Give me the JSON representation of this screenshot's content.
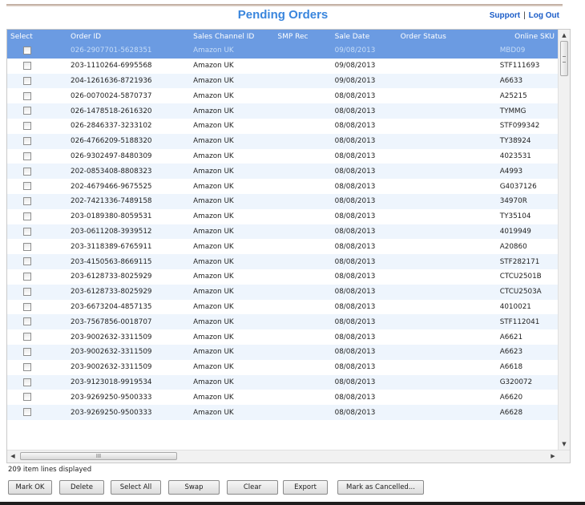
{
  "header": {
    "title": "Pending Orders",
    "support_label": "Support",
    "separator": "|",
    "logout_label": "Log Out"
  },
  "table": {
    "columns": [
      "Select",
      "Order ID",
      "Sales Channel ID",
      "SMP Rec",
      "Sale Date",
      "Order Status",
      "Online SKU"
    ],
    "rows": [
      {
        "order_id": "026-2907701-5628351",
        "channel": "Amazon UK",
        "smp": "",
        "date": "09/08/2013",
        "status": "",
        "sku": "MBD09",
        "selected": true
      },
      {
        "order_id": "203-1110264-6995568",
        "channel": "Amazon UK",
        "smp": "",
        "date": "09/08/2013",
        "status": "",
        "sku": "STF111693"
      },
      {
        "order_id": "204-1261636-8721936",
        "channel": "Amazon UK",
        "smp": "",
        "date": "09/08/2013",
        "status": "",
        "sku": "A6633"
      },
      {
        "order_id": "026-0070024-5870737",
        "channel": "Amazon UK",
        "smp": "",
        "date": "08/08/2013",
        "status": "",
        "sku": "A25215"
      },
      {
        "order_id": "026-1478518-2616320",
        "channel": "Amazon UK",
        "smp": "",
        "date": "08/08/2013",
        "status": "",
        "sku": "TYMMG"
      },
      {
        "order_id": "026-2846337-3233102",
        "channel": "Amazon UK",
        "smp": "",
        "date": "08/08/2013",
        "status": "",
        "sku": "STF099342"
      },
      {
        "order_id": "026-4766209-5188320",
        "channel": "Amazon UK",
        "smp": "",
        "date": "08/08/2013",
        "status": "",
        "sku": "TY38924"
      },
      {
        "order_id": "026-9302497-8480309",
        "channel": "Amazon UK",
        "smp": "",
        "date": "08/08/2013",
        "status": "",
        "sku": "4023531"
      },
      {
        "order_id": "202-0853408-8808323",
        "channel": "Amazon UK",
        "smp": "",
        "date": "08/08/2013",
        "status": "",
        "sku": "A4993"
      },
      {
        "order_id": "202-4679466-9675525",
        "channel": "Amazon UK",
        "smp": "",
        "date": "08/08/2013",
        "status": "",
        "sku": "G4037126"
      },
      {
        "order_id": "202-7421336-7489158",
        "channel": "Amazon UK",
        "smp": "",
        "date": "08/08/2013",
        "status": "",
        "sku": "34970R"
      },
      {
        "order_id": "203-0189380-8059531",
        "channel": "Amazon UK",
        "smp": "",
        "date": "08/08/2013",
        "status": "",
        "sku": "TY35104"
      },
      {
        "order_id": "203-0611208-3939512",
        "channel": "Amazon UK",
        "smp": "",
        "date": "08/08/2013",
        "status": "",
        "sku": "4019949"
      },
      {
        "order_id": "203-3118389-6765911",
        "channel": "Amazon UK",
        "smp": "",
        "date": "08/08/2013",
        "status": "",
        "sku": "A20860"
      },
      {
        "order_id": "203-4150563-8669115",
        "channel": "Amazon UK",
        "smp": "",
        "date": "08/08/2013",
        "status": "",
        "sku": "STF282171"
      },
      {
        "order_id": "203-6128733-8025929",
        "channel": "Amazon UK",
        "smp": "",
        "date": "08/08/2013",
        "status": "",
        "sku": "CTCU2501B"
      },
      {
        "order_id": "203-6128733-8025929",
        "channel": "Amazon UK",
        "smp": "",
        "date": "08/08/2013",
        "status": "",
        "sku": "CTCU2503A"
      },
      {
        "order_id": "203-6673204-4857135",
        "channel": "Amazon UK",
        "smp": "",
        "date": "08/08/2013",
        "status": "",
        "sku": "4010021"
      },
      {
        "order_id": "203-7567856-0018707",
        "channel": "Amazon UK",
        "smp": "",
        "date": "08/08/2013",
        "status": "",
        "sku": "STF112041"
      },
      {
        "order_id": "203-9002632-3311509",
        "channel": "Amazon UK",
        "smp": "",
        "date": "08/08/2013",
        "status": "",
        "sku": "A6621"
      },
      {
        "order_id": "203-9002632-3311509",
        "channel": "Amazon UK",
        "smp": "",
        "date": "08/08/2013",
        "status": "",
        "sku": "A6623"
      },
      {
        "order_id": "203-9002632-3311509",
        "channel": "Amazon UK",
        "smp": "",
        "date": "08/08/2013",
        "status": "",
        "sku": "A6618"
      },
      {
        "order_id": "203-9123018-9919534",
        "channel": "Amazon UK",
        "smp": "",
        "date": "08/08/2013",
        "status": "",
        "sku": "G320072"
      },
      {
        "order_id": "203-9269250-9500333",
        "channel": "Amazon UK",
        "smp": "",
        "date": "08/08/2013",
        "status": "",
        "sku": "A6620"
      },
      {
        "order_id": "203-9269250-9500333",
        "channel": "Amazon UK",
        "smp": "",
        "date": "08/08/2013",
        "status": "",
        "sku": "A6628"
      }
    ]
  },
  "scroll": {
    "up_arrow": "▲",
    "down_arrow": "▼",
    "left_arrow": "◀",
    "right_arrow": "▶",
    "grip": "III"
  },
  "status_line": "209 item lines displayed",
  "buttons": [
    "Mark OK",
    "Delete",
    "Select All",
    "Swap",
    "Clear",
    "Export",
    "Mark as Cancelled..."
  ],
  "colors": {
    "header_bg": "#6b9be2",
    "title": "#3a86dd",
    "link": "#1a5cc8",
    "row_alt": "#eef5fd"
  }
}
